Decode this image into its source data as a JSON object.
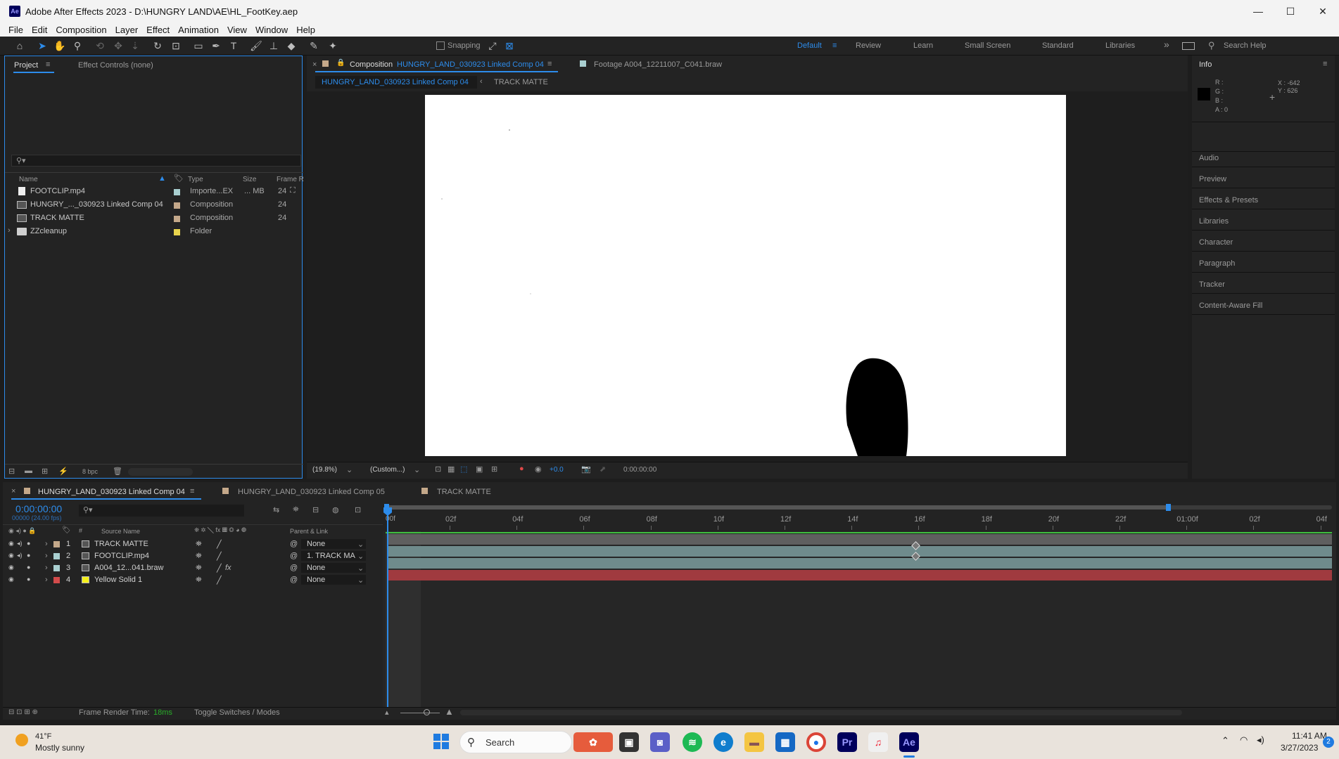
{
  "window": {
    "title": "Adobe After Effects 2023 - D:\\HUNGRY LAND\\AE\\HL_FootKey.aep",
    "app_icon": "Ae",
    "minimize": "—",
    "maximize": "☐",
    "close": "✕"
  },
  "menu": [
    "File",
    "Edit",
    "Composition",
    "Layer",
    "Effect",
    "Animation",
    "View",
    "Window",
    "Help"
  ],
  "toolbar": {
    "snapping_label": "Snapping",
    "workspaces": [
      "Default",
      "Review",
      "Learn",
      "Small Screen",
      "Standard",
      "Libraries"
    ],
    "active_workspace": "Default",
    "more": "»",
    "search_placeholder": "Search Help"
  },
  "project_panel": {
    "tab_project": "Project",
    "tab_effect_controls": "Effect Controls (none)",
    "columns": [
      "Name",
      "Type",
      "Size",
      "Frame R"
    ],
    "items": [
      {
        "name": "FOOTCLIP.mp4",
        "type": "Importe...EX",
        "size": "... MB",
        "fps": "24",
        "label_color": "#a9cfd0",
        "icon": "footage-icon"
      },
      {
        "name": "HUNGRY_..._030923 Linked Comp 04",
        "type": "Composition",
        "size": "",
        "fps": "24",
        "label_color": "#c4a88a",
        "icon": "composition-icon"
      },
      {
        "name": "TRACK MATTE",
        "type": "Composition",
        "size": "",
        "fps": "24",
        "label_color": "#c4a88a",
        "icon": "composition-icon"
      },
      {
        "name": "ZZcleanup",
        "type": "Folder",
        "size": "",
        "fps": "",
        "label_color": "#e8d44d",
        "icon": "folder-icon"
      }
    ],
    "bit_depth": "8 bpc"
  },
  "composition_panel": {
    "tab_label_prefix": "Composition",
    "tab_comp_name": "HUNGRY_LAND_030923 Linked Comp 04",
    "footage_tab": "Footage  A004_12211007_C041.braw",
    "breadcrumb_active": "HUNGRY_LAND_030923 Linked Comp 04",
    "breadcrumb_next": "TRACK MATTE",
    "zoom": "(19.8%)",
    "resolution": "(Custom...)",
    "exposure": "+0.0",
    "timecode": "0:00:00:00"
  },
  "info_panel": {
    "title": "Info",
    "r": "R :",
    "g": "G :",
    "b": "B :",
    "a": "A :  0",
    "x": "X : -642",
    "y": "Y : 626",
    "sections": [
      "Audio",
      "Preview",
      "Effects & Presets",
      "Libraries",
      "Character",
      "Paragraph",
      "Tracker",
      "Content-Aware Fill"
    ]
  },
  "timeline": {
    "tabs": [
      "HUNGRY_LAND_030923 Linked Comp 04",
      "HUNGRY_LAND_030923 Linked Comp 05",
      "TRACK MATTE"
    ],
    "timecode": "0:00:00:00",
    "fps_sub": "00000 (24.00 fps)",
    "header_source_name": "Source Name",
    "header_parent": "Parent & Link",
    "header_hash": "#",
    "ticks": [
      "02f",
      "04f",
      "06f",
      "08f",
      "10f",
      "12f",
      "14f",
      "16f",
      "18f",
      "20f",
      "22f",
      "01:00f",
      "02f",
      "04f"
    ],
    "playhead_label": "00f",
    "layers": [
      {
        "num": "1",
        "name": "TRACK MATTE",
        "parent": "None",
        "label_color": "#c4a88a",
        "bar_color": "#5f5f5f",
        "fx": ""
      },
      {
        "num": "2",
        "name": "FOOTCLIP.mp4",
        "parent": "1. TRACK MA",
        "label_color": "#a9cfd0",
        "bar_color": "#6f8b8c",
        "fx": ""
      },
      {
        "num": "3",
        "name": "A004_12...041.braw",
        "parent": "None",
        "label_color": "#a9cfd0",
        "bar_color": "#6f8b8c",
        "fx": "fx"
      },
      {
        "num": "4",
        "name": "Yellow Solid 1",
        "parent": "None",
        "label_color": "#d24b4b",
        "bar_color": "#a03a3f",
        "fx": ""
      }
    ],
    "footer_render_label": "Frame Render Time:",
    "footer_render_value": "18ms",
    "footer_toggle": "Toggle Switches / Modes"
  },
  "taskbar": {
    "weather_temp": "41°F",
    "weather_desc": "Mostly sunny",
    "search_label": "Search",
    "time": "11:41 AM",
    "date": "3/27/2023",
    "notification_count": "2"
  }
}
